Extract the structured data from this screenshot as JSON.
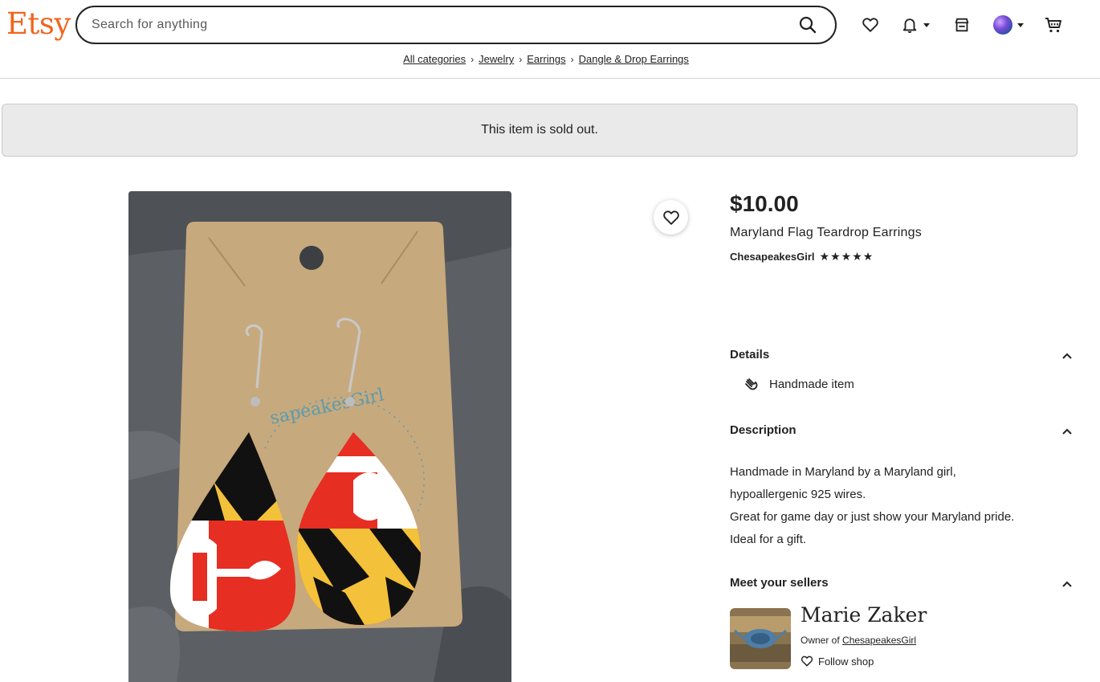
{
  "header": {
    "logo": "Etsy",
    "search_placeholder": "Search for anything",
    "colors": {
      "brand": "#F1641E"
    }
  },
  "breadcrumb": {
    "items": [
      "All categories",
      "Jewelry",
      "Earrings",
      "Dangle & Drop Earrings"
    ]
  },
  "banner": {
    "text": "This item is sold out."
  },
  "product": {
    "price": "$10.00",
    "title": "Maryland Flag Teardrop Earrings",
    "shop_name": "ChesapeakesGirl",
    "rating_stars": 5
  },
  "details": {
    "heading": "Details",
    "items": [
      "Handmade item"
    ]
  },
  "description": {
    "heading": "Description",
    "lines": [
      "Handmade in Maryland by a Maryland girl,",
      "hypoallergenic 925 wires.",
      "Great for game day or just show your Maryland pride.",
      "Ideal for a gift."
    ]
  },
  "sellers": {
    "heading": "Meet your sellers",
    "name": "Marie Zaker",
    "owner_prefix": "Owner of ",
    "owner_shop": "ChesapeakesGirl",
    "follow_label": "Follow shop"
  },
  "icons": {
    "search": "search-icon",
    "favorites": "heart-icon",
    "notifications": "bell-icon",
    "shop_manager": "store-icon",
    "cart": "cart-icon",
    "chevron": "chevron-up-icon",
    "handmade": "hand-icon"
  }
}
